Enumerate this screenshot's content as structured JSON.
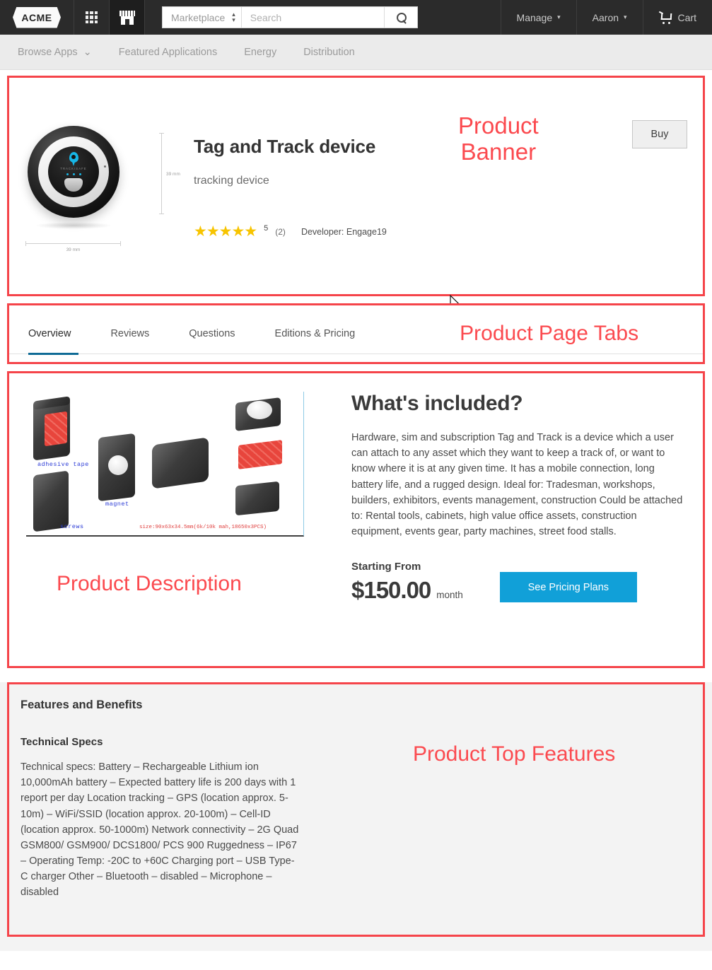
{
  "header": {
    "logo_text": "ACME",
    "apps_icon": "grid-apps-icon",
    "store_icon": "storefront-icon",
    "search": {
      "scope_label": "Marketplace",
      "placeholder": "Search",
      "search_icon": "search-icon"
    },
    "menu": [
      {
        "label": "Manage",
        "caret": "▾"
      },
      {
        "label": "Aaron",
        "caret": "▾"
      }
    ],
    "cart_label": "Cart"
  },
  "subnav": {
    "items": [
      {
        "label": "Browse Apps",
        "caret": "⌄"
      },
      {
        "label": "Featured Applications",
        "caret": ""
      },
      {
        "label": "Energy",
        "caret": ""
      },
      {
        "label": "Distribution",
        "caret": ""
      }
    ]
  },
  "banner": {
    "annotation": "Product\nBanner",
    "product": {
      "title": "Tag and Track device",
      "subtitle": "tracking device",
      "device_brand": "TRACKISAFE",
      "dim_width_label": "39 mm",
      "dim_height_label": "39 mm"
    },
    "rating": {
      "stars": "★★★★★",
      "value": "5",
      "count": "(2)",
      "developer": "Developer: Engage19"
    },
    "buy_label": "Buy"
  },
  "tabs": {
    "annotation": "Product Page Tabs",
    "items": [
      {
        "label": "Overview",
        "active": true
      },
      {
        "label": "Reviews",
        "active": false
      },
      {
        "label": "Questions",
        "active": false
      },
      {
        "label": "Editions & Pricing",
        "active": false
      }
    ]
  },
  "description": {
    "annotation": "Product Description",
    "image_labels": {
      "adhesive": "adhesive tape",
      "magnet": "magnet",
      "screws": "screws",
      "size": "size:90x63x34.5mm(6k/10k mah,18650x3PCS)"
    },
    "heading": "What's included?",
    "body": "Hardware, sim and subscription Tag and Track is a device which a user can attach to any asset which they want to keep a track of, or want to know where it is at any given time. It has a mobile connection, long battery life, and a rugged design. Ideal for: Tradesman, workshops, builders, exhibitors, events management, construction Could be attached to: Rental tools, cabinets, high value office assets, construction equipment, events gear, party machines, street food stalls.",
    "pricing": {
      "starting_label": "Starting From",
      "price": "$150.00",
      "period": "month",
      "cta_label": "See Pricing Plans"
    }
  },
  "features": {
    "annotation": "Product Top Features",
    "heading": "Features and Benefits",
    "subheading": "Technical Specs",
    "body": "Technical specs: Battery – Rechargeable Lithium ion 10,000mAh battery – Expected battery life is 200 days with 1 report per day Location tracking – GPS (location approx. 5-10m) – WiFi/SSID (location approx. 20-100m) – Cell-ID (location approx. 50-1000m) Network connectivity – 2G Quad GSM800/ GSM900/ DCS1800/ PCS 900 Ruggedness – IP67 – Operating Temp: -20C to +60C Charging port – USB Type- C charger Other – Bluetooth – disabled – Microphone – disabled"
  },
  "colors": {
    "annotation_red": "#fb4a4f",
    "cta_blue": "#11a0d8",
    "active_tab": "#0f6b96",
    "star_yellow": "#f7c400",
    "header_dark": "#2b2b2b"
  }
}
